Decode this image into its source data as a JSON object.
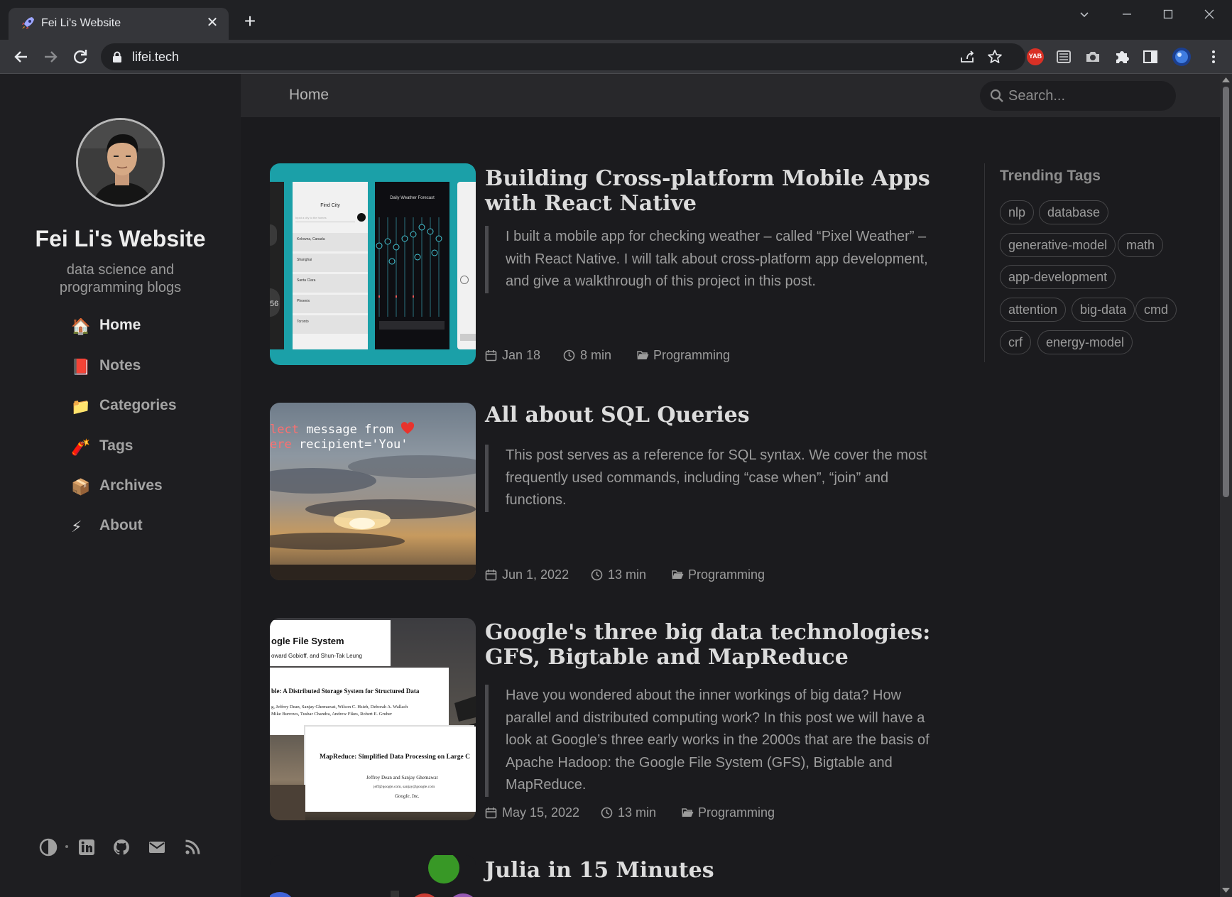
{
  "browser": {
    "tab_title": "Fei Li's Website",
    "url": "lifei.tech",
    "extension_badge": "YAB"
  },
  "sidebar": {
    "site_title": "Fei Li's Website",
    "tagline": "data science and programming blogs",
    "nav": [
      {
        "label": "Home",
        "emoji": "🏠",
        "active": true
      },
      {
        "label": "Notes",
        "emoji": "📕",
        "active": false
      },
      {
        "label": "Categories",
        "emoji": "📁",
        "active": false
      },
      {
        "label": "Tags",
        "emoji": "🧨",
        "active": false
      },
      {
        "label": "Archives",
        "emoji": "📦",
        "active": false
      },
      {
        "label": "About",
        "emoji": "⚡",
        "active": false
      }
    ],
    "footer_icons": [
      "theme-toggle-icon",
      "linkedin-icon",
      "github-icon",
      "email-icon",
      "rss-icon"
    ]
  },
  "topbar": {
    "breadcrumb": "Home",
    "search_placeholder": "Search..."
  },
  "posts": [
    {
      "title": "Building Cross-platform Mobile Apps with React Native",
      "excerpt": "I built a mobile app for checking weather – called “Pixel Weather” – with React Native. I will talk about cross-platform app development, and give a walkthrough of this project in this post.",
      "date": "Jan 18",
      "read_time": "8 min",
      "category": "Programming",
      "thumb_text": {
        "find_city": "Find City",
        "forecast": "Daily Weather Forecast",
        "city_hint": "Input a city to the homes",
        "cities": [
          "Kelowna, Canada",
          "Shanghai",
          "Santa Clara",
          "Phoenix",
          "Toronto"
        ],
        "side_number": "56"
      }
    },
    {
      "title": "All about SQL Queries",
      "excerpt": "This post serves as a reference for SQL syntax. We cover the most frequently used commands, including “case when”, “join” and functions.",
      "date": "Jun 1, 2022",
      "read_time": "13 min",
      "category": "Programming",
      "thumb_text": {
        "line1_kw": "lect",
        "line1_rest": " message from",
        "line2_kw": "ere",
        "line2_rest": " recipient='You'"
      }
    },
    {
      "title": "Google's three big data technologies: GFS, Bigtable and MapReduce",
      "excerpt": "Have you wondered about the inner workings of big data? How parallel and distributed computing work? In this post we will have a look at Google’s three early works in the 2000s that are the basis of Apache Hadoop: the Google File System (GFS), Bigtable and MapReduce.",
      "date": "May 15, 2022",
      "read_time": "13 min",
      "category": "Programming",
      "thumb_text": {
        "paper1_title": "ogle File System",
        "paper1_authors": "oward Gobioff, and Shun-Tak Leung",
        "paper2_title": "ble: A Distributed Storage System for Structured Data",
        "paper2_authors1": "g, Jeffrey Dean, Sanjay Ghemawat, Wilson C. Hsieh, Deborah A. Wallach",
        "paper2_authors2": "Mike Burrows, Tushar Chandra, Andrew Fikes, Robert E. Gruber",
        "paper3_title": "MapReduce: Simplified Data Processing on Large C",
        "paper3_authors": "Jeffrey Dean and Sanjay Ghemawat",
        "paper3_emails": "jeff@google.com, sanjay@google.com",
        "paper3_org": "Google, Inc."
      }
    },
    {
      "title": "Julia in 15 Minutes"
    }
  ],
  "trending": {
    "title": "Trending Tags",
    "tags": [
      "nlp",
      "database",
      "generative-model",
      "math",
      "app-development",
      "attention",
      "big-data",
      "cmd",
      "crf",
      "energy-model"
    ]
  },
  "colors": {
    "page_bg": "#1b1b1e",
    "sidebar_bg": "#1e1e21",
    "topbar_bg": "#28282b",
    "app_teal": "#1aa0a8",
    "sql_keyword": "#ff6f6f"
  }
}
